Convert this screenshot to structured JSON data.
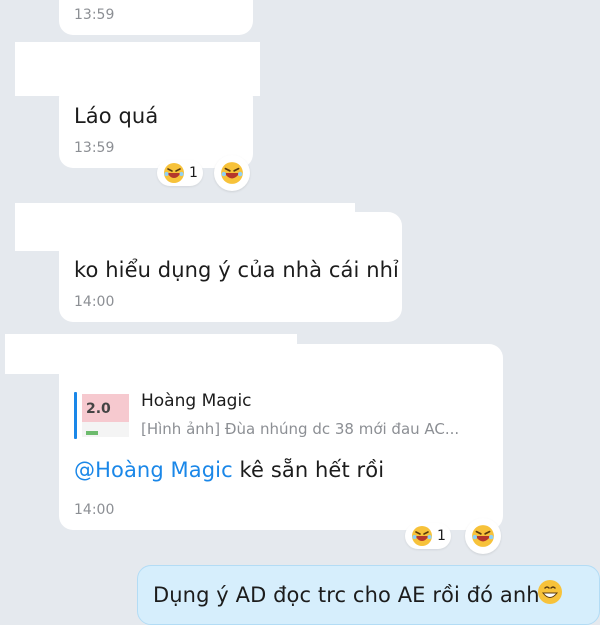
{
  "messages": [
    {
      "text": "",
      "time": "13:59"
    },
    {
      "text": "Láo quá",
      "time": "13:59",
      "reaction": {
        "emoji": "laughing-face",
        "count": "1"
      }
    },
    {
      "text": "ko hiểu dụng ý của nhà cái nhỉ",
      "time": "14:00"
    },
    {
      "quote": {
        "thumb_text": "2.0",
        "name": "Hoàng Magic",
        "preview": "[Hình ảnh] Đùa nhúng dc 38 mới đau AC..."
      },
      "mention": "@Hoàng Magic",
      "text": " kê sẵn hết rồi",
      "time": "14:00",
      "reaction": {
        "emoji": "laughing-face",
        "count": "1"
      }
    }
  ],
  "own_message": {
    "text": "Dụng ý AD đọc trc cho AE rồi đó anh",
    "emoji": "grinning-face"
  },
  "colors": {
    "background": "#e5e9ee",
    "bubble": "#ffffff",
    "own_bubble": "#d6eefc",
    "accent": "#1a87e8",
    "timestamp": "#8c8f94"
  }
}
